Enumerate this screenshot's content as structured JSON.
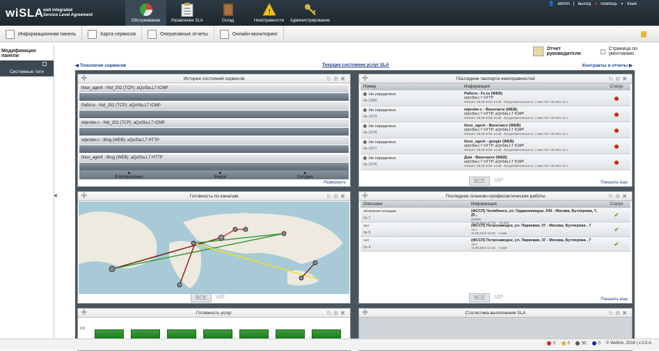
{
  "header": {
    "logo": "wiSLA",
    "logo_sub_1": "well integrated",
    "logo_sub_2": "Service Level Agreement",
    "nav": [
      {
        "label": "Обслуживание",
        "icon": "pie-chart-icon"
      },
      {
        "label": "Управление SLA",
        "icon": "clipboard-icon"
      },
      {
        "label": "Склад",
        "icon": "book-icon"
      },
      {
        "label": "Неисправности",
        "icon": "warning-icon"
      },
      {
        "label": "Администрирование",
        "icon": "keys-icon"
      }
    ],
    "user": "admin",
    "logout": "выход",
    "help": "помощь",
    "language": "язык"
  },
  "subnav": {
    "tabs": [
      "Информационная панель",
      "Карта сервисов",
      "Оперативные отчеты",
      "Онлайн-мониторинг"
    ]
  },
  "left": {
    "title": "Модификация панели",
    "tags": "Системные теги"
  },
  "bossbar": {
    "report": "Отчет руководителя",
    "default_page": "Страница по умолчанию"
  },
  "links": {
    "left": "Топология сервисов",
    "center": "Текущее состояние услуг SLA",
    "right": "Контракты и отчеты"
  },
  "history": {
    "title": "История состояний сервисов",
    "rows": [
      "linux_agent - Nid_202 (TCP): aQoSta.L7 ICMP",
      "Работа - Nid_202 (TCP): aQoSta.L7 ICMP",
      "wiprobe-c - Nid_202 (TCP): aQoSta.L7 ICMP",
      "wiprobe-c - Bing (WEB): aQoSta.L7 HTTP",
      "linux_agent - Bing (WEB): aQoSta.L7 HTTP"
    ],
    "axis": [
      "В воскресенье",
      "Вчера",
      "Сегодня"
    ],
    "expand": "Развернуть"
  },
  "passports": {
    "title": "Последние паспорта неисправностей",
    "col_num": "Номер",
    "col_info": "Информация",
    "col_status": "Статус",
    "rows": [
      {
        "state": "Не определено",
        "num": "№ 1080",
        "title": "Работа - Fs.to (WEB)",
        "line2": "aQoSta.L7 HTTP",
        "start": "Начало: 06.05.2016 14:35",
        "dur": "Продолжительность: 1 мин 18 ч 36 мин 12 с"
      },
      {
        "state": "Не определено",
        "num": "№ 1079",
        "title": "wiprobe-c - Вконтакте (WEB)",
        "line2": "aQoSta.L7 HTTP, aQoSta.L7 ICMP",
        "start": "Начало: 06.05.2016 14:35",
        "dur": "Продолжительность: 1 мин 18 ч 36 мин 12 с"
      },
      {
        "state": "Не определено",
        "num": "№ 1078",
        "title": "linux_agent - Вконтакте (WEB)",
        "line2": "aQoSta.L7 HTTP, aQoSta.L7 ICMP",
        "start": "Начало: 06.05.2016 14:35",
        "dur": "Продолжительность: 1 мин 18 ч 36 мин 12 с"
      },
      {
        "state": "Не определено",
        "num": "№ 1077",
        "title": "linux_agent - google (WEB)",
        "line2": "aQoSta.L7 HTTP, aQoSta.L7 ICMP",
        "start": "Начало: 06.05.2016 14:35",
        "dur": "Продолжительность: 1 мин 18 ч 36 мин 12 с"
      },
      {
        "state": "Не определено",
        "num": "№ 1076",
        "title": "Дом - Вконтакте (WEB)",
        "line2": "aQoSta.L7 HTTP, aQoSta.L7 ICMP",
        "start": "Начало: 06.05.2016 14:35",
        "dur": "Продолжительность: 1 мин 18 ч 36 мин 12 с"
      }
    ],
    "all": "ВСЕ",
    "vip": "VIP",
    "more": "Показать еще"
  },
  "channels": {
    "title": "Готовность по каналам",
    "all": "ВСЕ",
    "vip": "VIP"
  },
  "maintenance": {
    "title": "Последние планово-профилактические работы",
    "col_desc": "Описание",
    "col_info": "Информация",
    "col_status": "Статус",
    "rows": [
      {
        "desc": "обновление площадки",
        "num": "№ 7",
        "info": "(ФССП) Челябинск, ул. Орджоникидзе, 540 - Москва, Бутлерова, 7, (Р...",
        "sub": "Wellink",
        "date": "10.09.2014 17:35",
        "dur": "25 мин"
      },
      {
        "desc": "тест",
        "num": "№ 5",
        "info": "(ФССП) Петрозаводск, ул. Парковая, 37 - Москва, Бутлерова , 7",
        "sub": "тест",
        "date": "11.08.2014 15:46",
        "dur": "4 мин"
      },
      {
        "desc": "тест",
        "num": "№ 4",
        "info": "(ФССП) Петрозаводск, ул. Парковая, 37 - Москва, Бутлерова , 7",
        "sub": "тест",
        "date": "11.08.2014 14:42",
        "dur": "5 мин"
      }
    ],
    "all": "ВСЕ",
    "vip": "VIP",
    "more": "Показать еще"
  },
  "readiness": {
    "title": "Готовность услуг",
    "y_label": "100"
  },
  "sla": {
    "title": "Статистика выполнения SLA"
  },
  "statusbar": {
    "red": "0",
    "yellow": "0",
    "gray": "50",
    "blue": "0",
    "copyright": "© Wellink, 2016 | v.3.5.4."
  }
}
